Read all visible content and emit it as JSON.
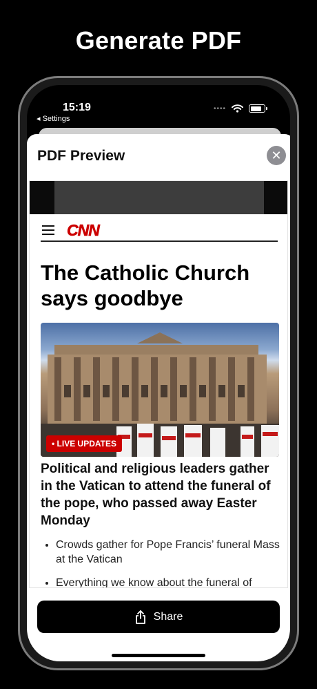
{
  "hero": {
    "title": "Generate PDF"
  },
  "status": {
    "time": "15:19",
    "back": "◂ Settings",
    "dots": "••••"
  },
  "sheet": {
    "title": "PDF Preview",
    "close_icon": "close-icon"
  },
  "article": {
    "logo": "CNN",
    "headline": "The Catholic Church says goodbye",
    "badge": "• LIVE UPDATES",
    "subhead": "Political and religious leaders gather in the Vatican to attend the funeral of the pope, who passed away Easter Monday",
    "bullets": [
      "Crowds gather for Pope Francis’ funeral Mass at the Vatican",
      "Everything we know about the funeral of"
    ]
  },
  "actions": {
    "share_label": "Share",
    "share_icon": "share-icon"
  },
  "colors": {
    "accent": "#cc0000",
    "button": "#000000"
  }
}
